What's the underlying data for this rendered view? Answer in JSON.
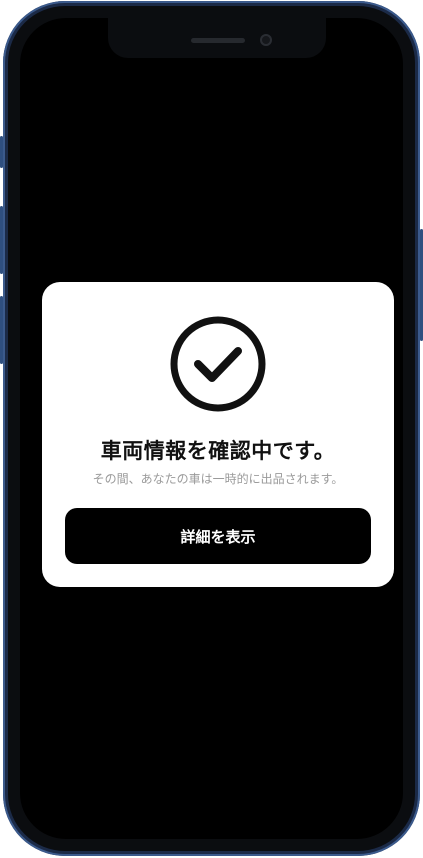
{
  "dialog": {
    "icon": "check-circle-icon",
    "title": "車両情報を確認中です。",
    "subtitle": "その間、あなたの車は一時的に出品されます。",
    "button_label": "詳細を表示"
  },
  "colors": {
    "screen_background": "#000000",
    "card_background": "#ffffff",
    "button_background": "#000000",
    "button_text": "#ffffff",
    "subtitle_text": "#9a9a9a",
    "phone_frame": "#1b2a47"
  }
}
